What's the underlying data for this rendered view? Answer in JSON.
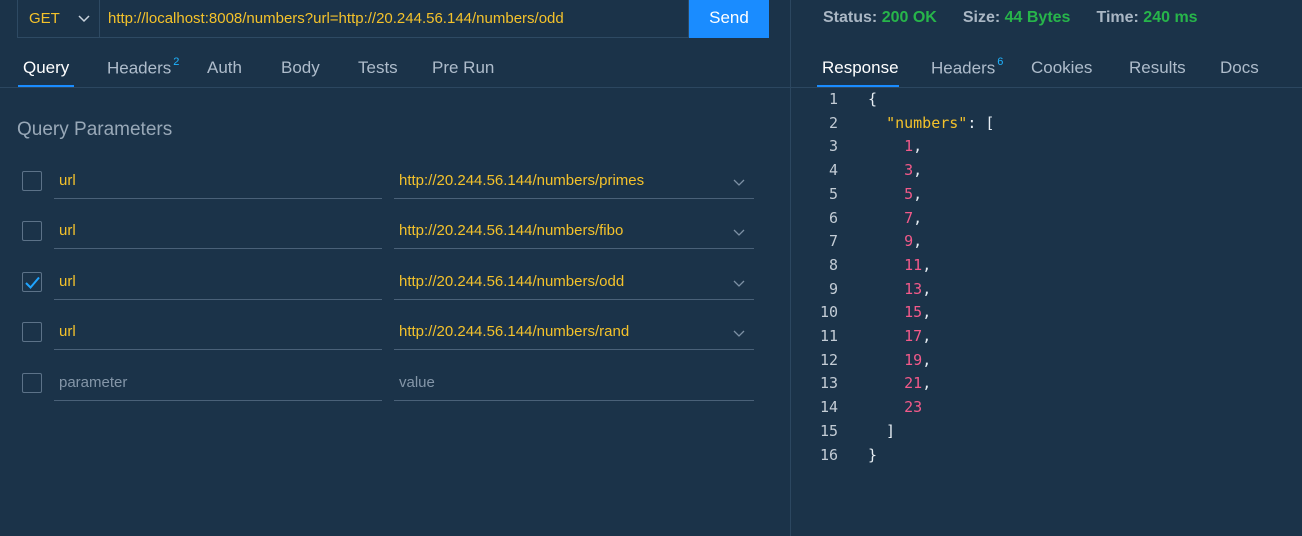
{
  "request": {
    "method": "GET",
    "url": "http://localhost:8008/numbers?url=http://20.244.56.144/numbers/odd",
    "send_label": "Send"
  },
  "request_tabs": [
    {
      "label": "Query",
      "badge": ""
    },
    {
      "label": "Headers",
      "badge": "2"
    },
    {
      "label": "Auth",
      "badge": ""
    },
    {
      "label": "Body",
      "badge": ""
    },
    {
      "label": "Tests",
      "badge": ""
    },
    {
      "label": "Pre Run",
      "badge": ""
    }
  ],
  "query": {
    "title": "Query Parameters",
    "params": [
      {
        "key": "url",
        "value": "http://20.244.56.144/numbers/primes",
        "checked": false
      },
      {
        "key": "url",
        "value": "http://20.244.56.144/numbers/fibo",
        "checked": false
      },
      {
        "key": "url",
        "value": "http://20.244.56.144/numbers/odd",
        "checked": true
      },
      {
        "key": "url",
        "value": "http://20.244.56.144/numbers/rand",
        "checked": false
      }
    ],
    "new_param": {
      "key_placeholder": "parameter",
      "value_placeholder": "value"
    }
  },
  "status": {
    "status_label": "Status:",
    "status_value": "200 OK",
    "size_label": "Size:",
    "size_value": "44 Bytes",
    "time_label": "Time:",
    "time_value": "240 ms"
  },
  "response_tabs": [
    {
      "label": "Response",
      "badge": ""
    },
    {
      "label": "Headers",
      "badge": "6"
    },
    {
      "label": "Cookies",
      "badge": ""
    },
    {
      "label": "Results",
      "badge": ""
    },
    {
      "label": "Docs",
      "badge": ""
    }
  ],
  "response": {
    "json_key": "numbers",
    "numbers": [
      "1",
      "3",
      "5",
      "7",
      "9",
      "11",
      "13",
      "15",
      "17",
      "19",
      "21",
      "23"
    ]
  },
  "colors": {
    "background": "#1b3349",
    "accent": "#1a8cff",
    "value_yellow": "#f4c22b",
    "status_green": "#27b54a",
    "number_pink": "#f35a8a"
  }
}
